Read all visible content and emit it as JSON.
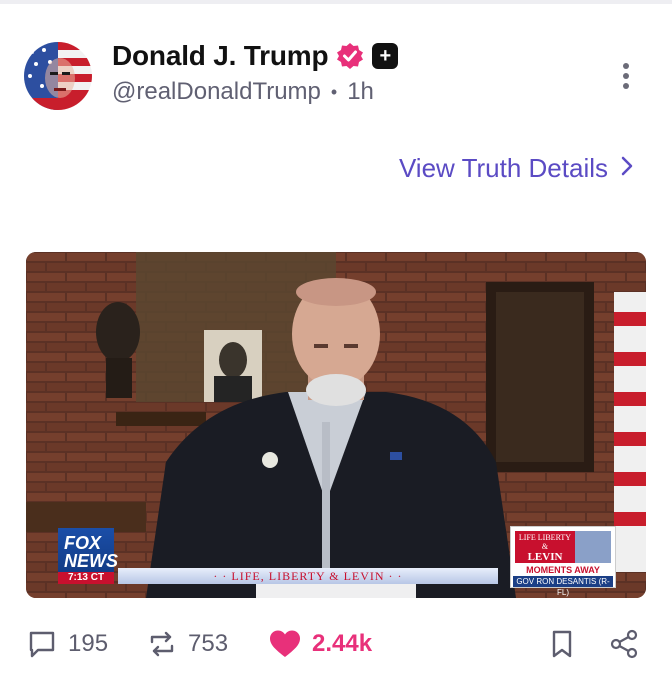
{
  "post": {
    "author": {
      "display_name": "Donald J. Trump",
      "handle": "@realDonaldTrump",
      "time_ago": "1h",
      "separator": "•"
    },
    "view_details_label": "View Truth Details",
    "media": {
      "network_logo_text": "FOX NEWS",
      "clock_text": "7:13 CT",
      "lower_third_text": "· · LIFE, LIBERTY & LEVIN · ·",
      "promo_show_top": "LIFE LIBERTY &",
      "promo_show_name": "LEVIN",
      "promo_moments": "MOMENTS AWAY",
      "promo_guest": "GOV RON DESANTIS (R-FL)"
    },
    "stats": {
      "replies": "195",
      "retruths": "753",
      "likes": "2.44k"
    }
  },
  "colors": {
    "accent": "#5b4bc4",
    "like": "#e8307a",
    "verified": "#e8307a",
    "muted": "#5d5d6e"
  },
  "icons": [
    "verified-badge-icon",
    "plus-badge-icon",
    "more-options-icon",
    "chevron-right-icon",
    "reply-icon",
    "retruth-icon",
    "heart-icon",
    "bookmark-icon",
    "share-icon"
  ]
}
